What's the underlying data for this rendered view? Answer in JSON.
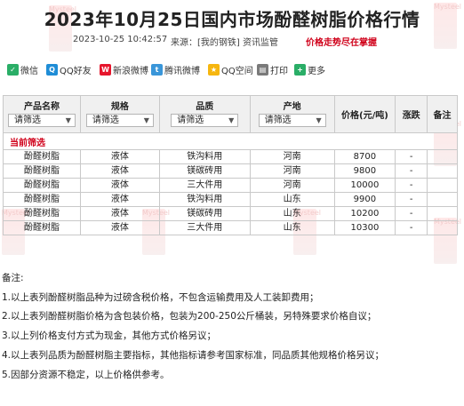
{
  "page": {
    "title": "2023年10月25日国内市场酚醛树脂价格行情",
    "date": "2023-10-25 10:42:57",
    "source": "来源：[我的钢铁] 资讯监管",
    "warning": "价格走势尽在掌握",
    "watermark": "Mysteel"
  },
  "share": {
    "items": [
      {
        "label": "微信",
        "icon": "wechat-icon",
        "color": "#2aae67"
      },
      {
        "label": "QQ好友",
        "icon": "qq-icon",
        "color": "#1f8dd6"
      },
      {
        "label": "新浪微博",
        "icon": "weibo-icon",
        "color": "#e6162d"
      },
      {
        "label": "腾讯微博",
        "icon": "tencent-weibo-icon",
        "color": "#3a96d9"
      },
      {
        "label": "QQ空间",
        "icon": "qzone-icon",
        "color": "#f6b60f"
      },
      {
        "label": "打印",
        "icon": "print-icon",
        "color": "#7a7a7a"
      },
      {
        "label": "更多",
        "icon": "more-icon",
        "color": "#2aae67"
      }
    ]
  },
  "table": {
    "headers": {
      "product": "产品名称",
      "spec": "规格",
      "material": "品质",
      "origin": "产地",
      "price": "价格(元/吨)",
      "change": "涨跌",
      "remark": "备注"
    },
    "filter_placeholder": "请筛选",
    "current_filter": "当前筛选",
    "rows": [
      {
        "product": "酚醛树脂",
        "spec": "液体",
        "material": "铁沟料用",
        "origin": "河南",
        "price": "8700",
        "change": "-",
        "remark": ""
      },
      {
        "product": "酚醛树脂",
        "spec": "液体",
        "material": "镁碳砖用",
        "origin": "河南",
        "price": "9800",
        "change": "-",
        "remark": ""
      },
      {
        "product": "酚醛树脂",
        "spec": "液体",
        "material": "三大件用",
        "origin": "河南",
        "price": "10000",
        "change": "-",
        "remark": ""
      },
      {
        "product": "酚醛树脂",
        "spec": "液体",
        "material": "铁沟料用",
        "origin": "山东",
        "price": "9900",
        "change": "-",
        "remark": ""
      },
      {
        "product": "酚醛树脂",
        "spec": "液体",
        "material": "镁碳砖用",
        "origin": "山东",
        "price": "10200",
        "change": "-",
        "remark": ""
      },
      {
        "product": "酚醛树脂",
        "spec": "液体",
        "material": "三大件用",
        "origin": "山东",
        "price": "10300",
        "change": "-",
        "remark": ""
      }
    ]
  },
  "notes": {
    "heading": "备注:",
    "items": [
      "1.以上表列酚醛树脂品种为过磅含税价格，不包含运输费用及人工装卸费用；",
      "2.以上表列酚醛树脂价格为含包装价格，包装为200-250公斤桶装，另特殊要求价格自议；",
      "3.以上列价格支付方式为现金，其他方式价格另议；",
      "4.以上表列品质为酚醛树脂主要指标，其他指标请参考国家标准，同品质其他规格价格另议；",
      "5.因部分资源不稳定，以上价格供参考。"
    ]
  }
}
